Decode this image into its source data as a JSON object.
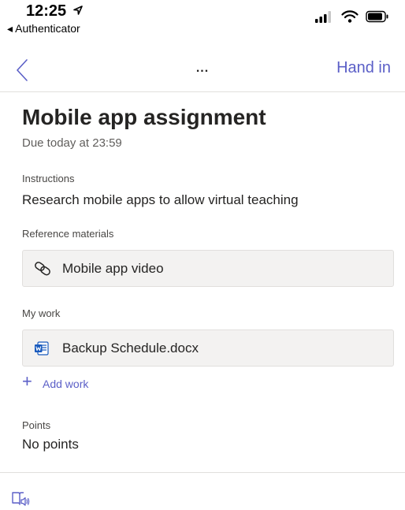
{
  "status_bar": {
    "time": "12:25",
    "back_app": "Authenticator",
    "icons": [
      "location-arrow-icon",
      "signal-icon",
      "wifi-icon",
      "battery-icon"
    ]
  },
  "nav": {
    "back_icon": "chevron-left-icon",
    "more": "...",
    "hand_in": "Hand in"
  },
  "assignment": {
    "title": "Mobile app assignment",
    "due": "Due today at 23:59",
    "instructions_label": "Instructions",
    "instructions_text": "Research mobile apps to allow virtual teaching",
    "reference_label": "Reference materials",
    "reference_item": "Mobile app video",
    "my_work_label": "My work",
    "work_item": "Backup Schedule.docx",
    "add_work": "Add work",
    "points_label": "Points",
    "points_value": "No points"
  },
  "bottom": {
    "reader_icon": "immersive-reader-icon"
  },
  "colors": {
    "accent": "#5b5fc7",
    "card_bg": "#f3f2f1",
    "word_blue": "#185abd"
  }
}
